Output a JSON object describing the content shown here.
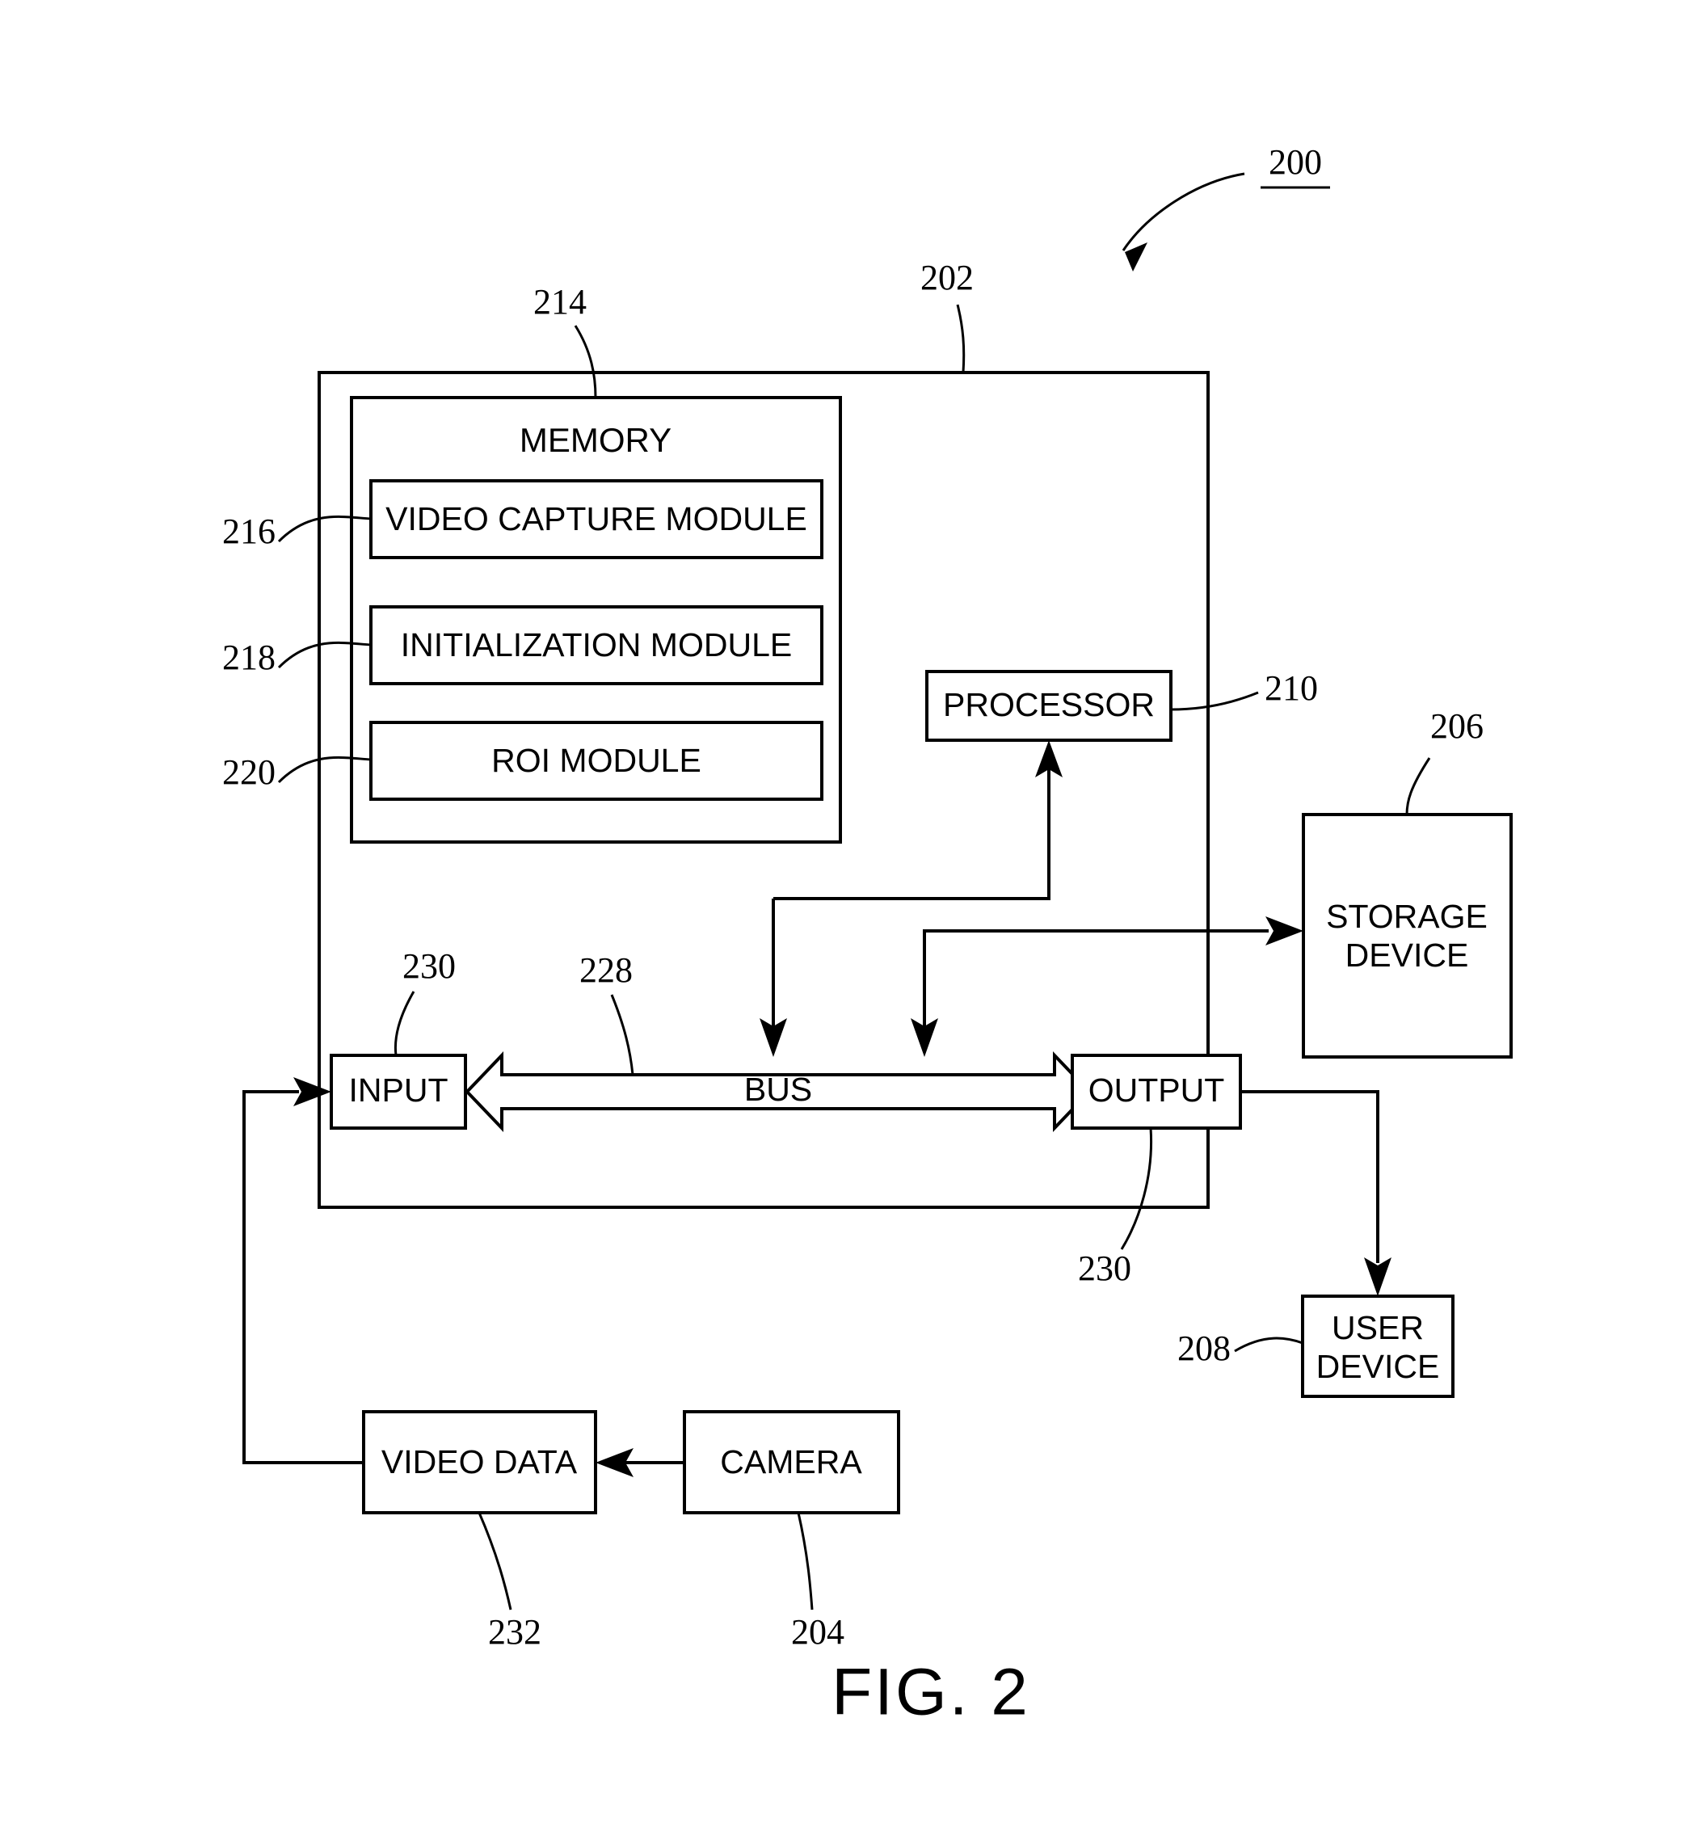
{
  "figure": {
    "caption": "FIG. 2",
    "system_ref": "200"
  },
  "boxes": {
    "device": {
      "ref": "202",
      "label": ""
    },
    "memory": {
      "ref": "214",
      "label": "MEMORY"
    },
    "video_capture_module": {
      "ref": "216",
      "label": "VIDEO CAPTURE MODULE"
    },
    "initialization_module": {
      "ref": "218",
      "label": "INITIALIZATION MODULE"
    },
    "roi_module": {
      "ref": "220",
      "label": "ROI MODULE"
    },
    "processor": {
      "ref": "210",
      "label": "PROCESSOR"
    },
    "storage_device": {
      "ref": "206",
      "label_line1": "STORAGE",
      "label_line2": "DEVICE"
    },
    "user_device": {
      "ref": "208",
      "label_line1": "USER",
      "label_line2": "DEVICE"
    },
    "input": {
      "ref": "230",
      "label": "INPUT"
    },
    "output": {
      "ref": "230",
      "label": "OUTPUT"
    },
    "bus": {
      "ref": "228",
      "label": "BUS"
    },
    "video_data": {
      "ref": "232",
      "label": "VIDEO DATA"
    },
    "camera": {
      "ref": "204",
      "label": "CAMERA"
    }
  },
  "reference_numerals": [
    {
      "id": "ref-200",
      "value": "200",
      "underlined": true
    },
    {
      "id": "ref-202",
      "value": "202",
      "underlined": false
    },
    {
      "id": "ref-204",
      "value": "204",
      "underlined": false
    },
    {
      "id": "ref-206",
      "value": "206",
      "underlined": false
    },
    {
      "id": "ref-208",
      "value": "208",
      "underlined": false
    },
    {
      "id": "ref-210",
      "value": "210",
      "underlined": false
    },
    {
      "id": "ref-214",
      "value": "214",
      "underlined": false
    },
    {
      "id": "ref-216",
      "value": "216",
      "underlined": false
    },
    {
      "id": "ref-218",
      "value": "218",
      "underlined": false
    },
    {
      "id": "ref-220",
      "value": "220",
      "underlined": false
    },
    {
      "id": "ref-228",
      "value": "228",
      "underlined": false
    },
    {
      "id": "ref-230-input",
      "value": "230",
      "underlined": false
    },
    {
      "id": "ref-230-output",
      "value": "230",
      "underlined": false
    },
    {
      "id": "ref-232",
      "value": "232",
      "underlined": false
    }
  ],
  "colors": {
    "ink": "#000000",
    "paper": "#ffffff"
  }
}
